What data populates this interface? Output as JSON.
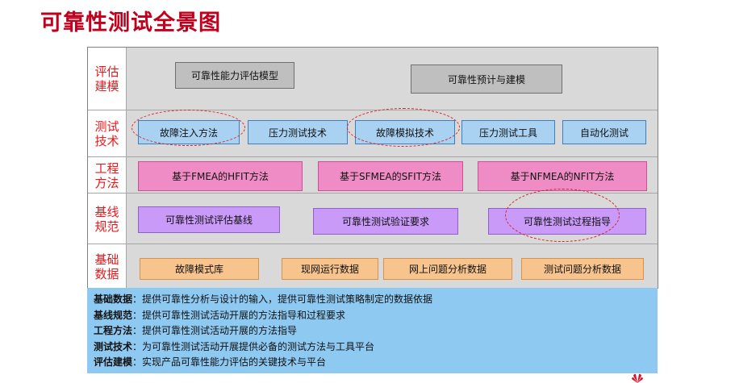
{
  "title": "可靠性测试全景图",
  "rows": [
    {
      "label": "评估\n建模",
      "boxes": [
        "可靠性能力评估模型",
        "可靠性预计与建模"
      ]
    },
    {
      "label": "测试\n技术",
      "boxes": [
        "故障注入方法",
        "压力测试技术",
        "故障模拟技术",
        "压力测试工具",
        "自动化测试"
      ]
    },
    {
      "label": "工程\n方法",
      "boxes": [
        "基于FMEA的HFIT方法",
        "基于SFMEA的SFIT方法",
        "基于NFMEA的NFIT方法"
      ]
    },
    {
      "label": "基线\n规范",
      "boxes": [
        "可靠性测试评估基线",
        "可靠性测试验证要求",
        "可靠性测试过程指导"
      ]
    },
    {
      "label": "基础\n数据",
      "boxes": [
        "故障模式库",
        "现网运行数据",
        "网上问题分析数据",
        "测试问题分析数据"
      ]
    }
  ],
  "descriptions": [
    {
      "term": "基础数据",
      "text": "：提供可靠性分析与设计的输入，提供可靠性测试策略制定的数据依据"
    },
    {
      "term": "基线规范",
      "text": "：提供可靠性测试活动开展的方法指导和过程要求"
    },
    {
      "term": "工程方法",
      "text": "：提供可靠性测试活动开展的方法指导"
    },
    {
      "term": "测试技术",
      "text": "：为可靠性测试活动开展提供必备的测试方法与工具平台"
    },
    {
      "term": "评估建模",
      "text": "：实现产品可靠性能力评估的关键技术与平台"
    }
  ],
  "colors": {
    "title": "#c0001c",
    "row_label": "#e8191c",
    "row_bg": "#d9d9d9",
    "gray_box": "#bfbfbf",
    "blue_box": "#a9d2f2",
    "pink_box": "#f08cc5",
    "purple_box": "#c99af7",
    "orange_box": "#f7c48e",
    "desc_bg": "#8ec9f2",
    "highlight_ellipse": "#d9232a"
  }
}
